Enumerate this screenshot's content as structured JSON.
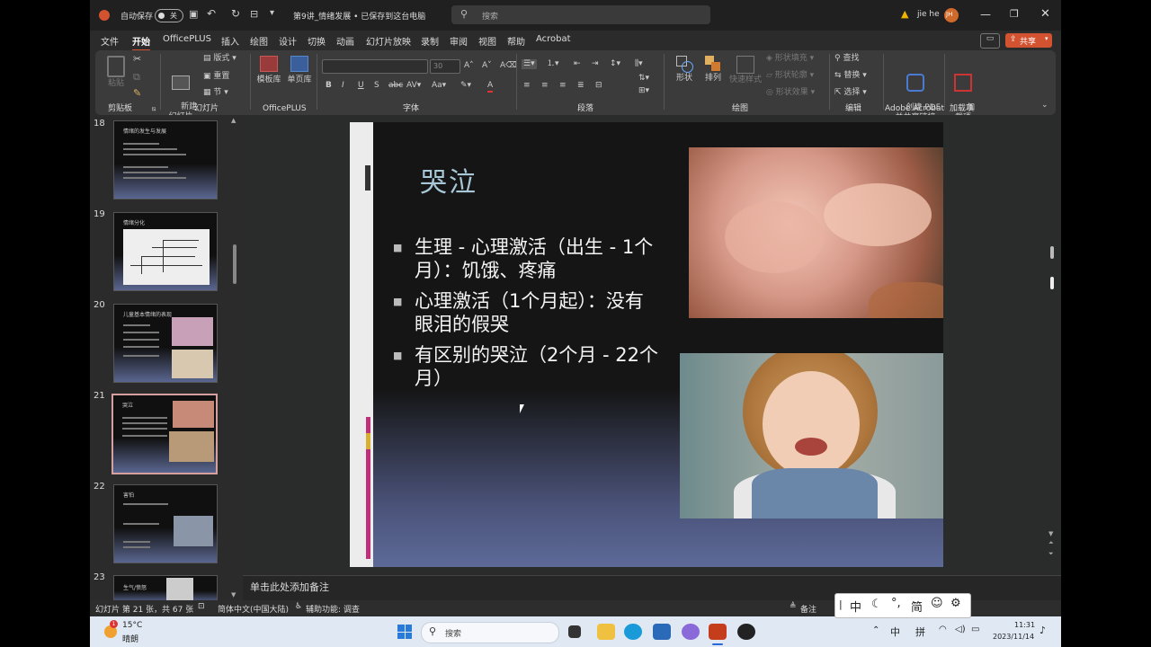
{
  "titlebar": {
    "autosave_label": "自动保存",
    "autosave_state": "关",
    "doc_title": "第9讲_情绪发展 • 已保存到这台电脑",
    "search_placeholder": "搜索",
    "user_name": "jie he",
    "user_initials": "JH"
  },
  "tabs": [
    "文件",
    "开始",
    "OfficePLUS",
    "插入",
    "绘图",
    "设计",
    "切换",
    "动画",
    "幻灯片放映",
    "录制",
    "审阅",
    "视图",
    "帮助",
    "Acrobat"
  ],
  "active_tab": "开始",
  "share_label": "共享",
  "ribbon": {
    "groups": [
      "剪贴板",
      "幻灯片",
      "OfficePLUS",
      "字体",
      "段落",
      "绘图",
      "编辑",
      "Adobe Acrobat",
      "加载项"
    ],
    "paste": "粘贴",
    "new_slide": "新建\n幻灯片",
    "layout": "版式",
    "reset": "重置",
    "section": "节",
    "template_lib": "模板库",
    "single_lib": "单页库",
    "font_size": "30",
    "shapes": "形状",
    "arrange": "排列",
    "quick_styles": "快速样式",
    "shape_fill": "形状填充",
    "shape_outline": "形状轮廓",
    "shape_effects": "形状效果",
    "find": "查找",
    "replace": "替换",
    "select": "选择",
    "create_pdf": "创建 PDF\n并共享链接",
    "addins": "加\n载项"
  },
  "thumbnails": [
    {
      "num": "18",
      "title": "情绪的发生与发展"
    },
    {
      "num": "19",
      "title": "情绪分化"
    },
    {
      "num": "20",
      "title": "儿童基本情绪的表现"
    },
    {
      "num": "21",
      "title": "哭泣"
    },
    {
      "num": "22",
      "title": "害怕"
    },
    {
      "num": "23",
      "title": "生气/愤怒"
    }
  ],
  "selected_thumb": "21",
  "slide": {
    "title": "哭泣",
    "bullets": [
      "生理 - 心理激活（出生 - 1个月）：饥饿、疼痛",
      "心理激活（1个月起）：没有眼泪的假哭",
      "有区别的哭泣（2个月 - 22个月）"
    ]
  },
  "notes_placeholder": "单击此处添加备注",
  "status": {
    "slide_info": "幻灯片 第 21 张，共 67 张",
    "language": "简体中文(中国大陆)",
    "accessibility": "辅助功能: 调查",
    "notes_btn": "备注"
  },
  "taskbar": {
    "temp": "15°C",
    "weather": "晴朗",
    "search": "搜索",
    "ime1": "中",
    "ime2": "拼",
    "time": "11:31",
    "date": "2023/11/14"
  },
  "ime_bar": [
    "中",
    "简"
  ],
  "colors": {
    "accent": "#d35230",
    "taskbar": "#dfe8f3",
    "slide_gradient": "#5d6a98"
  }
}
